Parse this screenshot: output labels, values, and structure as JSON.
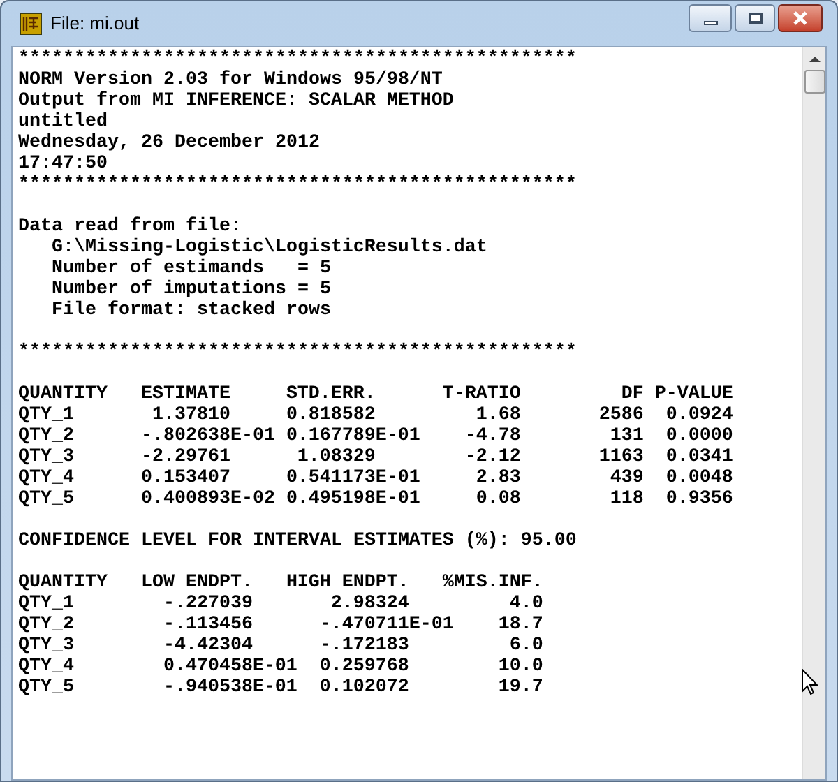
{
  "window": {
    "title": "File: mi.out"
  },
  "blocks": [
    {
      "kind": "line",
      "text": "**************************************************"
    },
    {
      "kind": "line",
      "text": "NORM Version 2.03 for Windows 95/98/NT"
    },
    {
      "kind": "line",
      "text": "Output from MI INFERENCE: SCALAR METHOD"
    },
    {
      "kind": "line",
      "text": "untitled"
    },
    {
      "kind": "line",
      "text": "Wednesday, 26 December 2012"
    },
    {
      "kind": "line",
      "text": "17:47:50"
    },
    {
      "kind": "line",
      "text": "**************************************************"
    },
    {
      "kind": "blank"
    },
    {
      "kind": "line",
      "text": "Data read from file:"
    },
    {
      "kind": "indented",
      "text": "G:\\Missing-Logistic\\LogisticResults.dat"
    },
    {
      "kind": "indented",
      "text": "Number of estimands   = 5"
    },
    {
      "kind": "indented",
      "text": "Number of imputations = 5"
    },
    {
      "kind": "indented",
      "text": "File format: stacked rows"
    },
    {
      "kind": "blank"
    },
    {
      "kind": "line",
      "text": "**************************************************"
    },
    {
      "kind": "blank"
    },
    {
      "kind": "table",
      "columns": [
        "QUANTITY",
        "ESTIMATE",
        "STD.ERR.",
        "T-RATIO",
        "DF",
        "P-VALUE"
      ],
      "rows": [
        [
          "QTY_1",
          " 1.37810",
          "0.818582",
          "1.68",
          "2586",
          "0.0924"
        ],
        [
          "QTY_2",
          "-.802638E-01",
          "0.167789E-01",
          "-4.78",
          "131",
          "0.0000"
        ],
        [
          "QTY_3",
          "-2.29761",
          " 1.08329",
          "-2.12",
          "1163",
          "0.0341"
        ],
        [
          "QTY_4",
          "0.153407",
          "0.541173E-01",
          "2.83",
          "439",
          "0.0048"
        ],
        [
          "QTY_5",
          "0.400893E-02",
          "0.495198E-01",
          "0.08",
          "118",
          "0.9356"
        ]
      ]
    },
    {
      "kind": "blank"
    },
    {
      "kind": "line",
      "text": "CONFIDENCE LEVEL FOR INTERVAL ESTIMATES (%): 95.00"
    },
    {
      "kind": "blank"
    },
    {
      "kind": "table",
      "columns": [
        "QUANTITY",
        "LOW ENDPT.",
        "HIGH ENDPT.",
        "%MIS.INF."
      ],
      "rows": [
        [
          "QTY_1",
          "-.227039",
          " 2.98324",
          "4.0"
        ],
        [
          "QTY_2",
          "-.113456",
          "-.470711E-01",
          "18.7"
        ],
        [
          "QTY_3",
          "-4.42304",
          "-.172183",
          "6.0"
        ],
        [
          "QTY_4",
          "0.470458E-01",
          "0.259768",
          "10.0"
        ],
        [
          "QTY_5",
          "-.940538E-01",
          "0.102072",
          "19.7"
        ]
      ]
    }
  ]
}
